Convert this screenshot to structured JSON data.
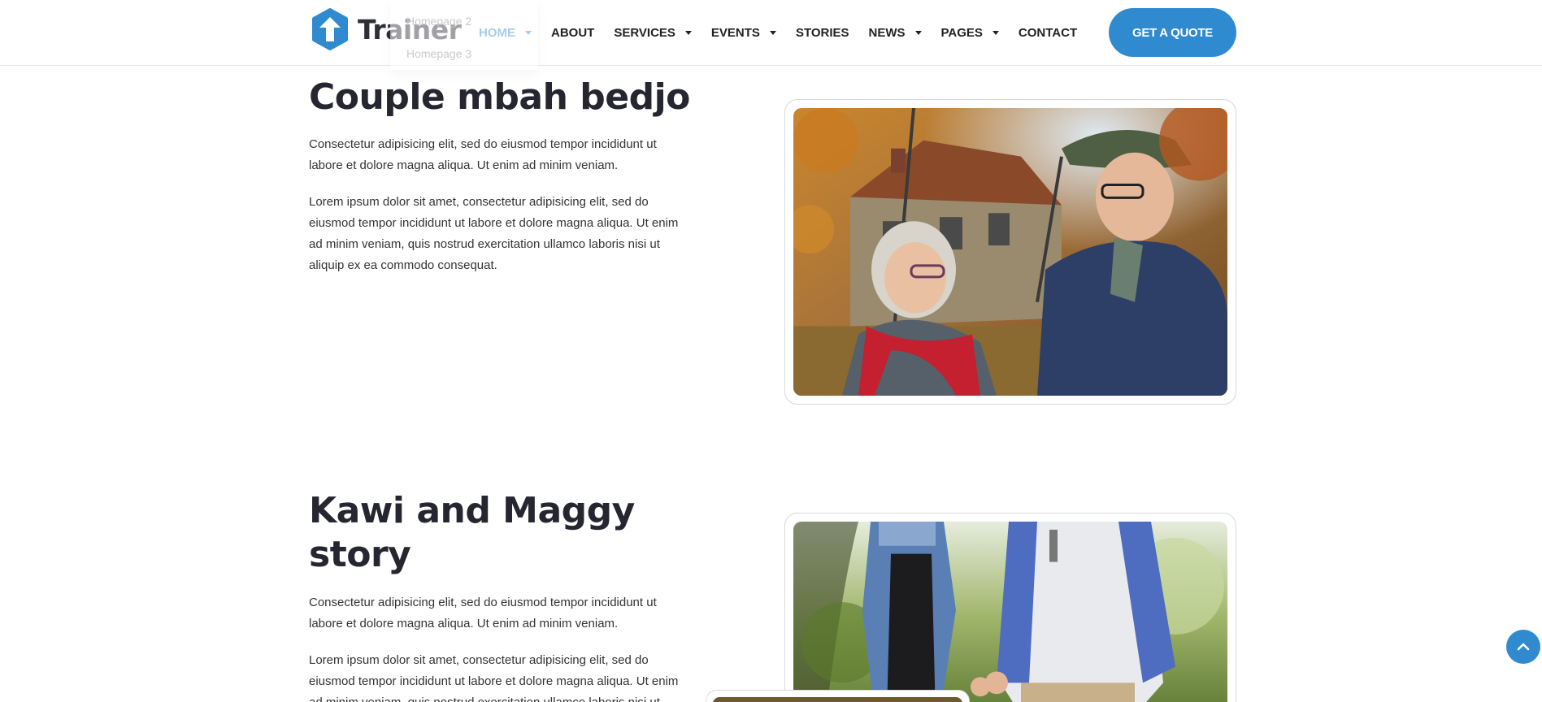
{
  "brand": {
    "name": "Trainer",
    "color": "#2f8ad0"
  },
  "nav": {
    "items": [
      {
        "label": "HOME",
        "has_dropdown": true,
        "active": true
      },
      {
        "label": "ABOUT",
        "has_dropdown": false
      },
      {
        "label": "SERVICES",
        "has_dropdown": true
      },
      {
        "label": "EVENTS",
        "has_dropdown": true
      },
      {
        "label": "STORIES",
        "has_dropdown": false
      },
      {
        "label": "NEWS",
        "has_dropdown": true
      },
      {
        "label": "PAGES",
        "has_dropdown": true
      },
      {
        "label": "CONTACT",
        "has_dropdown": false
      }
    ],
    "cta_label": "GET A QUOTE",
    "dropdown_items": [
      "Homepage 2",
      "Homepage 3"
    ]
  },
  "stories": [
    {
      "title": "Couple mbah bedjo",
      "p1": "Consectetur adipisicing elit, sed do eiusmod tempor incididunt ut labore et dolore magna aliqua. Ut enim ad minim veniam.",
      "p2": "Lorem ipsum dolor sit amet, consectetur adipisicing elit, sed do eiusmod tempor incididunt ut labore et dolore magna aliqua. Ut enim ad minim veniam, quis nostrud exercitation ullamco laboris nisi ut aliquip ex ea commodo consequat."
    },
    {
      "title": "Kawi and Maggy story",
      "p1": "Consectetur adipisicing elit, sed do eiusmod tempor incididunt ut labore et dolore magna aliqua. Ut enim ad minim veniam.",
      "p2": "Lorem ipsum dolor sit amet, consectetur adipisicing elit, sed do eiusmod tempor incididunt ut labore et dolore magna aliqua. Ut enim ad minim veniam, quis nostrud exercitation ullamco laboris nisi ut aliquip ex ea commodo consequat."
    }
  ],
  "icons": {
    "scroll_top": "chevron-up-icon",
    "logo": "arrow-up-icon"
  }
}
